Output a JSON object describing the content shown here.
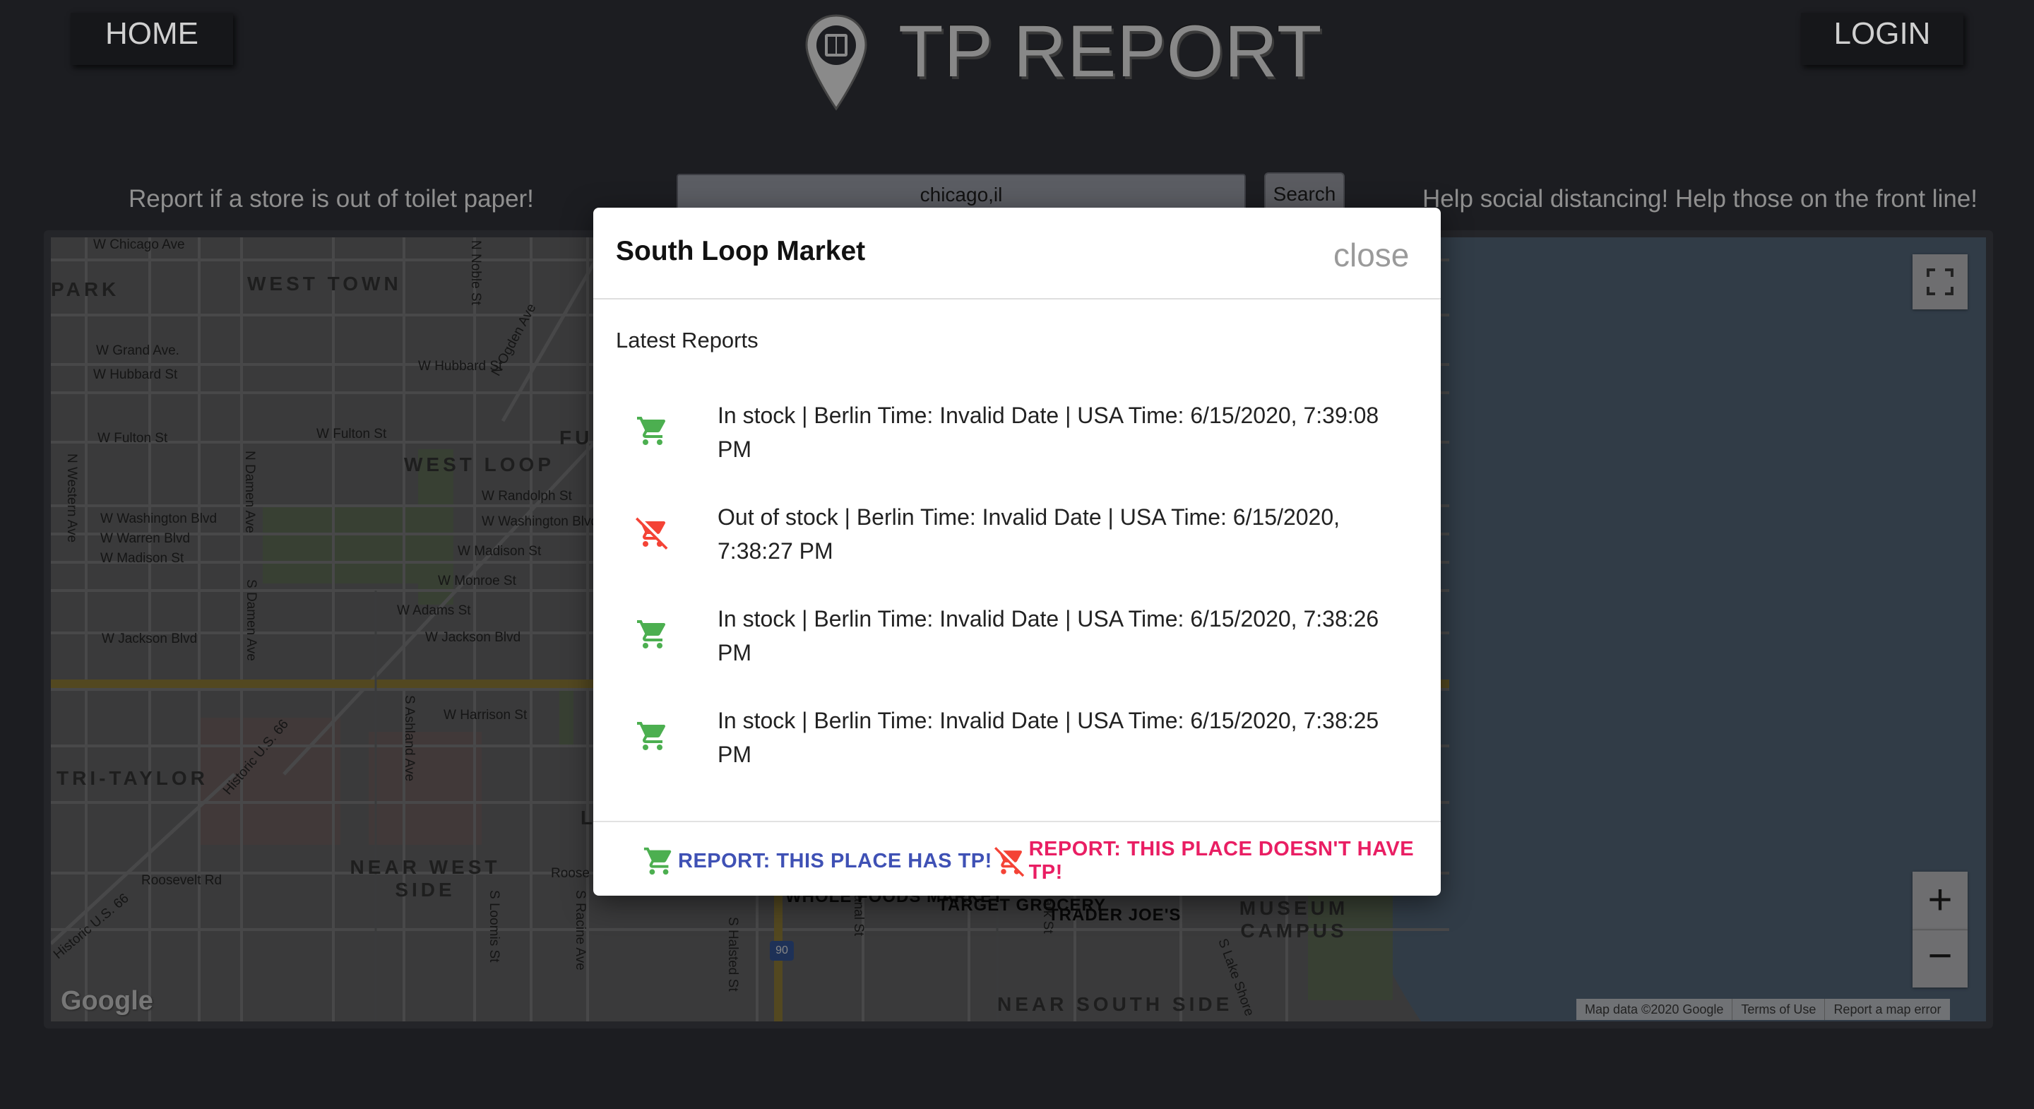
{
  "header": {
    "home_label": "HOME",
    "login_label": "LOGIN",
    "brand": "TP REPORT",
    "tagline_left": "Report if a store is out of toilet paper!",
    "tagline_right": "Help social distancing! Help those on the front line!"
  },
  "search": {
    "value": "chicago,il",
    "button_label": "Search"
  },
  "map": {
    "neighborhoods": [
      "PARK",
      "WEST TOWN",
      "WEST LOOP",
      "TRI-TAYLOR",
      "NEAR WEST SIDE",
      "MUSEUM CAMPUS",
      "NEAR SOUTH SIDE",
      "FU",
      "L"
    ],
    "streets": [
      "W Chicago Ave",
      "W Grand Ave.",
      "W Hubbard St",
      "W Hubbard St",
      "W Fulton St",
      "W Fulton St",
      "W Randolph St",
      "W Washington Blvd",
      "W Washington Blvd",
      "W Warren Blvd",
      "W Madison St",
      "W Madison St",
      "W Monroe St",
      "W Adams St",
      "W Jackson Blvd",
      "W Jackson Blvd",
      "W Harrison St",
      "Roosevelt Rd",
      "Roose",
      "N Noble St",
      "N Ogden Ave",
      "N Western Ave",
      "N Damen Ave",
      "S Damen Ave",
      "S Ashland Ave",
      "Historic U.S. 66",
      "Historic U.S. 66",
      "S Loomis St",
      "S Racine Ave",
      "S Halsted St",
      "S Lake Shore",
      "anal St",
      "ark St"
    ],
    "places": [
      "WHOLE FOODS MARKET",
      "TARGET GROCERY",
      "TRADER JOE'S"
    ],
    "highway_shields": [
      "90"
    ],
    "google_logo": "Google",
    "footer": [
      "Map data ©2020 Google",
      "Terms of Use",
      "Report a map error"
    ],
    "zoom_in": "+",
    "zoom_out": "−"
  },
  "modal": {
    "title": "South Loop Market",
    "close_label": "close",
    "section_label": "Latest Reports",
    "reports": [
      {
        "status": "in",
        "icon": "shopping-cart-icon",
        "text": "In stock | Berlin Time: Invalid Date | USA Time: 6/15/2020, 7:39:08 PM"
      },
      {
        "status": "out",
        "icon": "remove-shopping-cart-icon",
        "text": "Out of stock | Berlin Time: Invalid Date | USA Time: 6/15/2020, 7:38:27 PM"
      },
      {
        "status": "in",
        "icon": "shopping-cart-icon",
        "text": "In stock | Berlin Time: Invalid Date | USA Time: 6/15/2020, 7:38:26 PM"
      },
      {
        "status": "in",
        "icon": "shopping-cart-icon",
        "text": "In stock | Berlin Time: Invalid Date | USA Time: 6/15/2020, 7:38:25 PM"
      }
    ],
    "action_has": "REPORT: THIS PLACE HAS TP!",
    "action_hasnt": "REPORT: THIS PLACE DOESN'T HAVE TP!"
  },
  "colors": {
    "page_bg": "#1c1d21",
    "in_stock": "#4caf50",
    "out_of_stock": "#f44336",
    "action_has": "#3f51b5",
    "action_hasnt": "#e91e63"
  }
}
